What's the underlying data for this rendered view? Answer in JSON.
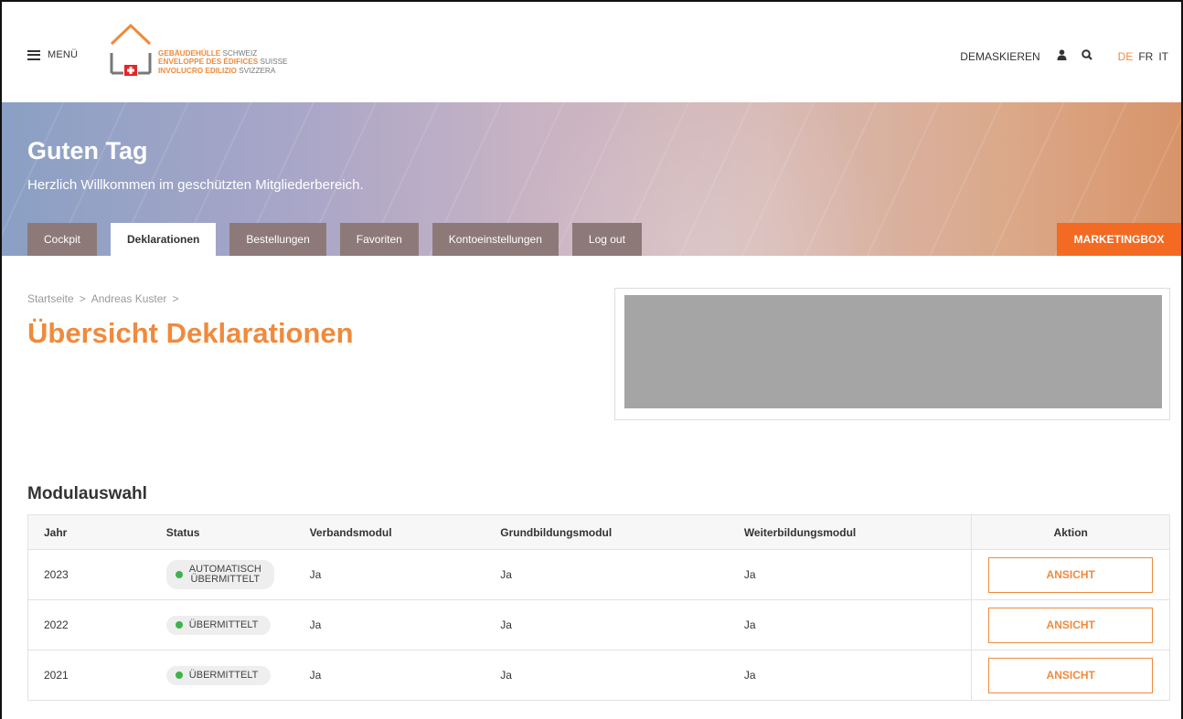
{
  "header": {
    "menu_label": "MENÜ",
    "logo_lines": [
      {
        "bold": "GEBÄUDEHÜLLE",
        "normal": "SCHWEIZ"
      },
      {
        "bold": "ENVELOPPE DES ÉDIFICES",
        "normal": "SUISSE"
      },
      {
        "bold": "INVOLUCRO EDILIZIO",
        "normal": "SVIZZERA"
      }
    ],
    "demask_label": "DEMASKIEREN",
    "icons": [
      "user-icon",
      "search-icon"
    ],
    "languages": [
      {
        "label": "DE",
        "active": true
      },
      {
        "label": "FR",
        "active": false
      },
      {
        "label": "IT",
        "active": false
      }
    ]
  },
  "hero": {
    "title": "Guten Tag",
    "subtitle": "Herzlich Willkommen im geschützten Mitgliederbereich.",
    "tabs": [
      {
        "label": "Cockpit",
        "active": false
      },
      {
        "label": "Deklarationen",
        "active": true
      },
      {
        "label": "Bestellungen",
        "active": false
      },
      {
        "label": "Favoriten",
        "active": false
      },
      {
        "label": "Kontoeinstellungen",
        "active": false
      },
      {
        "label": "Log out",
        "active": false
      }
    ],
    "marketingbox_label": "MARKETINGBOX"
  },
  "breadcrumb": [
    "Startseite",
    ">",
    "Andreas Kuster",
    ">"
  ],
  "page_title": "Übersicht Deklarationen",
  "module_section": {
    "title": "Modulauswahl",
    "columns": [
      "Jahr",
      "Status",
      "Verbandsmodul",
      "Grundbildungsmodul",
      "Weiterbildungsmodul",
      "Aktion"
    ],
    "rows": [
      {
        "year": "2023",
        "status_line1": "AUTOMATISCH",
        "status_line2": "ÜBERMITTELT",
        "verband": "Ja",
        "grund": "Ja",
        "weiter": "Ja",
        "action": "ANSICHT"
      },
      {
        "year": "2022",
        "status_line1": "ÜBERMITTELT",
        "status_line2": "",
        "verband": "Ja",
        "grund": "Ja",
        "weiter": "Ja",
        "action": "ANSICHT"
      },
      {
        "year": "2021",
        "status_line1": "ÜBERMITTELT",
        "status_line2": "",
        "verband": "Ja",
        "grund": "Ja",
        "weiter": "Ja",
        "action": "ANSICHT"
      }
    ]
  },
  "colors": {
    "accent": "#f08a3c",
    "marketingbox": "#f36a22",
    "status_dot": "#3db34a"
  }
}
